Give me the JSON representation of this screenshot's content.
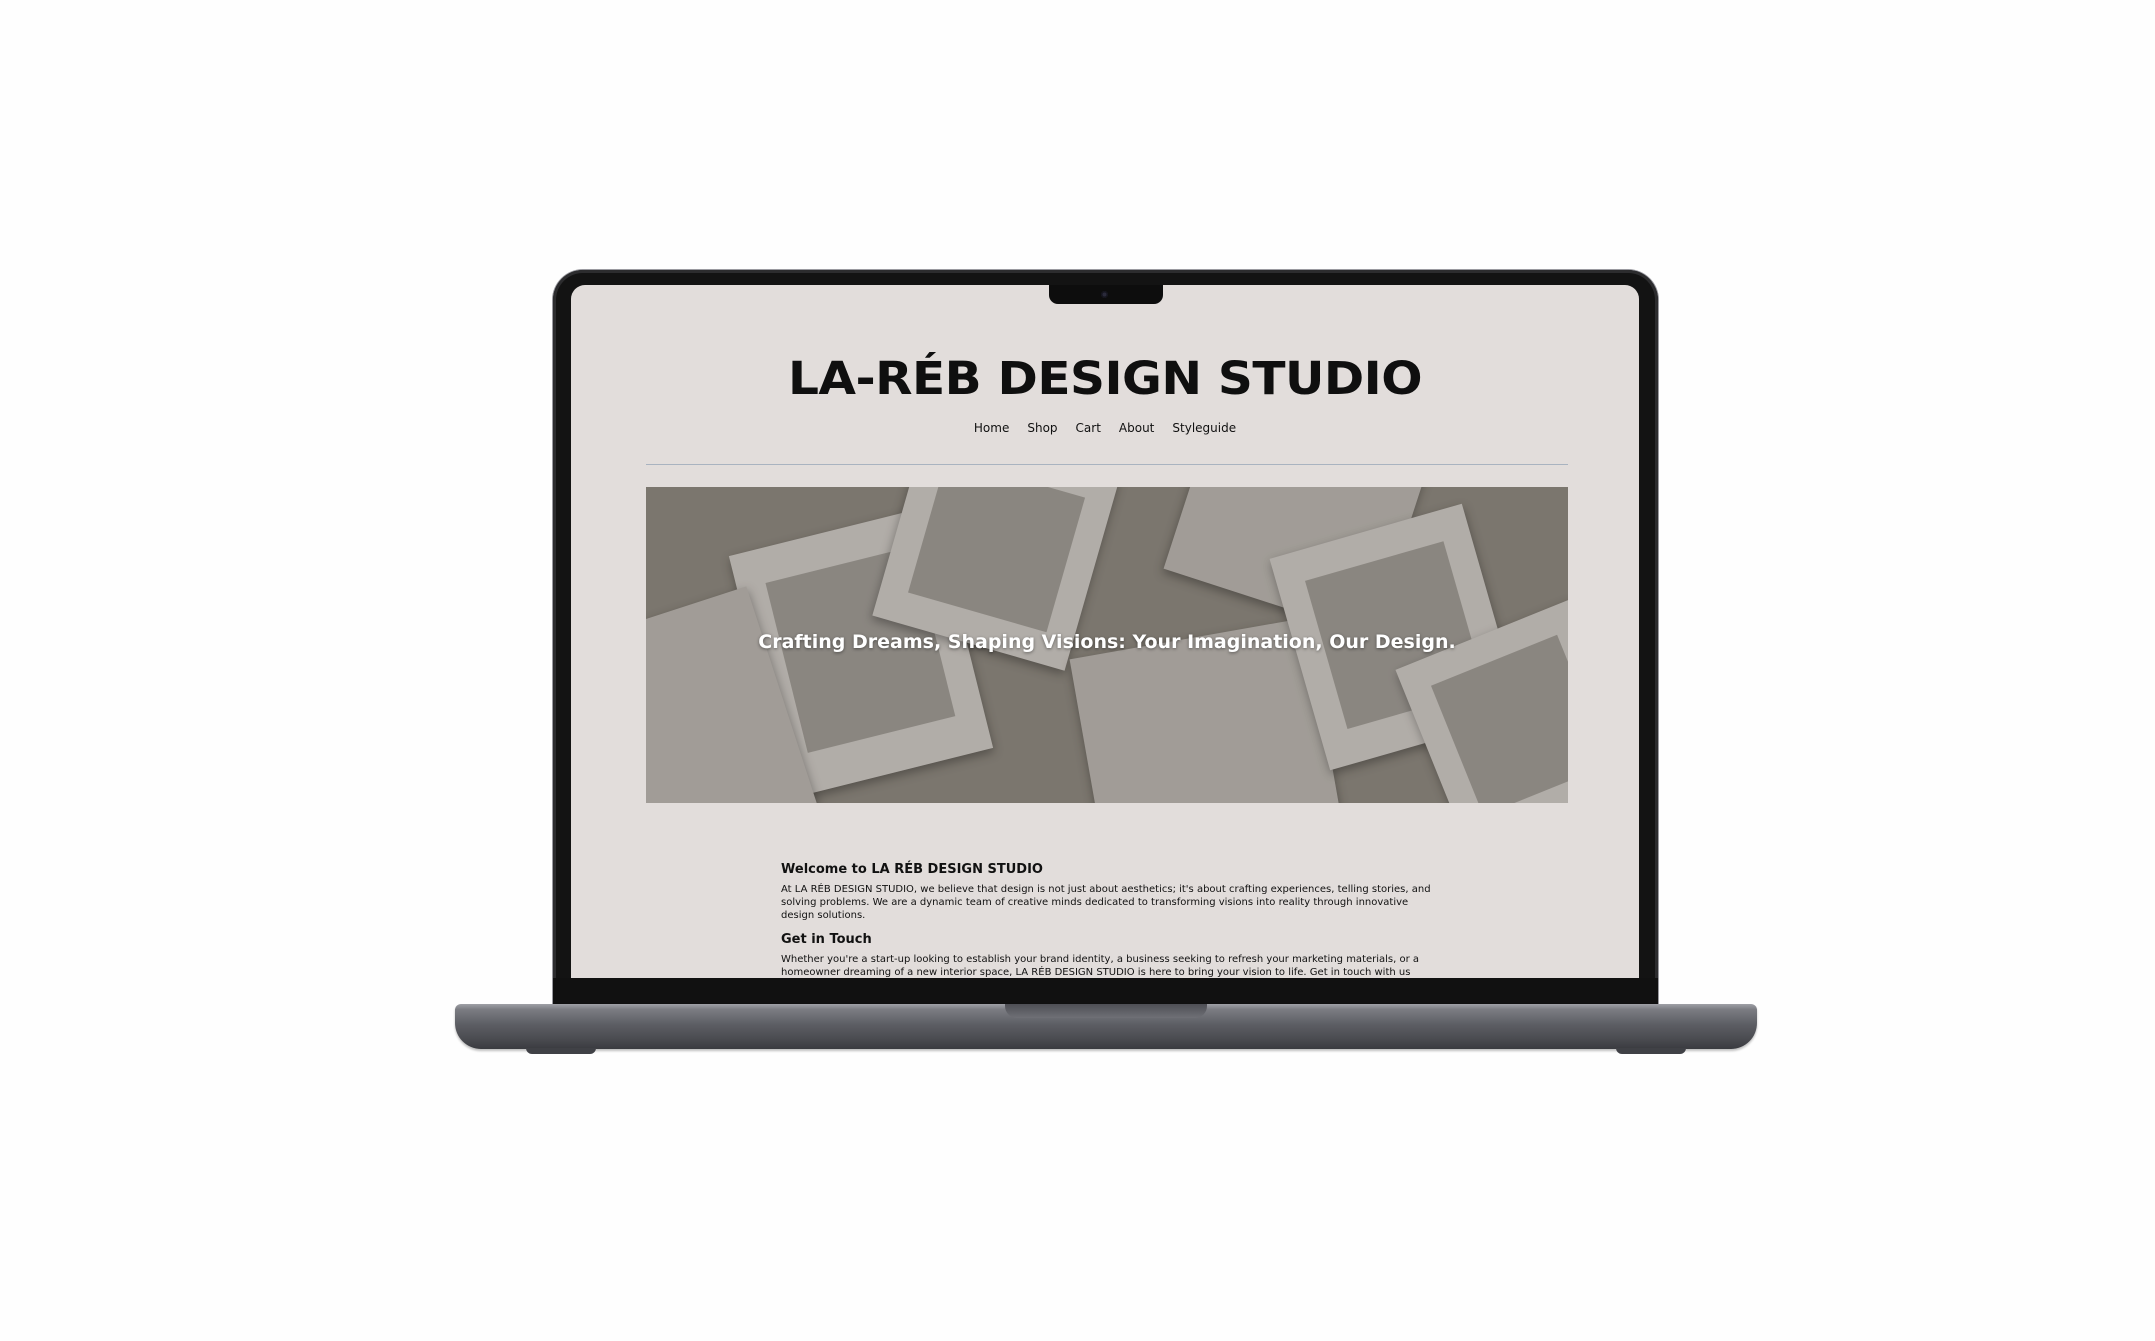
{
  "site": {
    "title": "LA-RÉB DESIGN STUDIO"
  },
  "nav": {
    "items": [
      "Home",
      "Shop",
      "Cart",
      "About",
      "Styleguide"
    ]
  },
  "hero": {
    "tagline": "Crafting Dreams, Shaping Visions: Your Imagination, Our Design."
  },
  "content": {
    "welcome_heading": "Welcome to LA RÉB DESIGN STUDIO",
    "welcome_text": "At LA RÉB DESIGN STUDIO, we believe that design is not just about aesthetics; it's about crafting experiences, telling stories, and solving problems. We are a dynamic team of creative minds dedicated to transforming visions into reality through innovative design solutions.",
    "contact_heading": "Get in Touch",
    "contact_text": "Whether you're a start-up looking to establish your brand identity, a business seeking to refresh your marketing materials, or a homeowner dreaming of a new interior space, LA RÉB DESIGN STUDIO is here to bring your vision to life. Get in touch with us today, and let's embark on a journey of creativity, passion, and design excellence."
  },
  "colors": {
    "page_background": "#e2dddb",
    "text": "#111111",
    "divider": "#a9b3c0",
    "hero_background": "#89847a"
  }
}
